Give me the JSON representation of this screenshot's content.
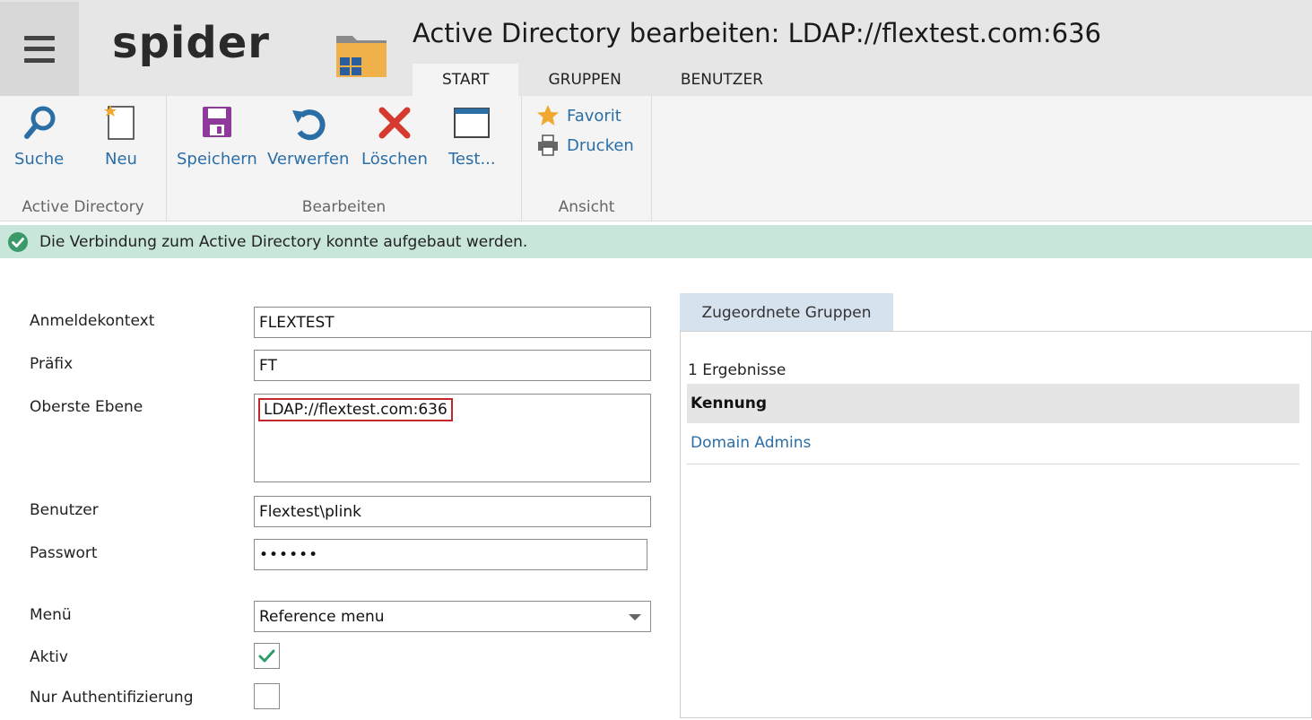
{
  "header": {
    "logo": "spider",
    "title": "Active Directory bearbeiten: LDAP://flextest.com:636",
    "tabs": [
      {
        "label": "START",
        "active": true
      },
      {
        "label": "GRUPPEN",
        "active": false
      },
      {
        "label": "BENUTZER",
        "active": false
      }
    ]
  },
  "ribbon": {
    "groups": [
      {
        "label": "Active Directory",
        "buttons": [
          {
            "label": "Suche",
            "icon": "search-icon"
          },
          {
            "label": "Neu",
            "icon": "new-document-icon"
          }
        ]
      },
      {
        "label": "Bearbeiten",
        "buttons": [
          {
            "label": "Speichern",
            "icon": "save-icon"
          },
          {
            "label": "Verwerfen",
            "icon": "undo-icon"
          },
          {
            "label": "Löschen",
            "icon": "delete-icon"
          },
          {
            "label": "Test...",
            "icon": "window-icon"
          }
        ]
      },
      {
        "label": "Ansicht",
        "buttons": [
          {
            "label": "Favorit",
            "icon": "star-icon"
          },
          {
            "label": "Drucken",
            "icon": "printer-icon"
          }
        ]
      }
    ]
  },
  "status": {
    "message": "Die Verbindung zum Active Directory konnte aufgebaut werden.",
    "icon": "check-circle-icon",
    "color": "#c9e6da"
  },
  "form": {
    "anmeldekontext": {
      "label": "Anmeldekontext",
      "value": "FLEXTEST"
    },
    "praefix": {
      "label": "Präfix",
      "value": "FT"
    },
    "oberste_ebene": {
      "label": "Oberste Ebene",
      "value": "LDAP://flextest.com:636"
    },
    "benutzer": {
      "label": "Benutzer",
      "value": "Flextest\\plink"
    },
    "passwort": {
      "label": "Passwort",
      "value": "••••••"
    },
    "menu": {
      "label": "Menü",
      "value": "Reference menu"
    },
    "aktiv": {
      "label": "Aktiv",
      "checked": true
    },
    "nur_auth": {
      "label": "Nur Authentifizierung",
      "checked": false
    }
  },
  "groups_panel": {
    "tab_label": "Zugeordnete Gruppen",
    "result_count": "1 Ergebnisse",
    "column_header": "Kennung",
    "rows": [
      "Domain Admins"
    ]
  },
  "colors": {
    "accent": "#2b6ea6",
    "status_bg": "#c9e6da",
    "highlight_border": "#c0282d"
  }
}
